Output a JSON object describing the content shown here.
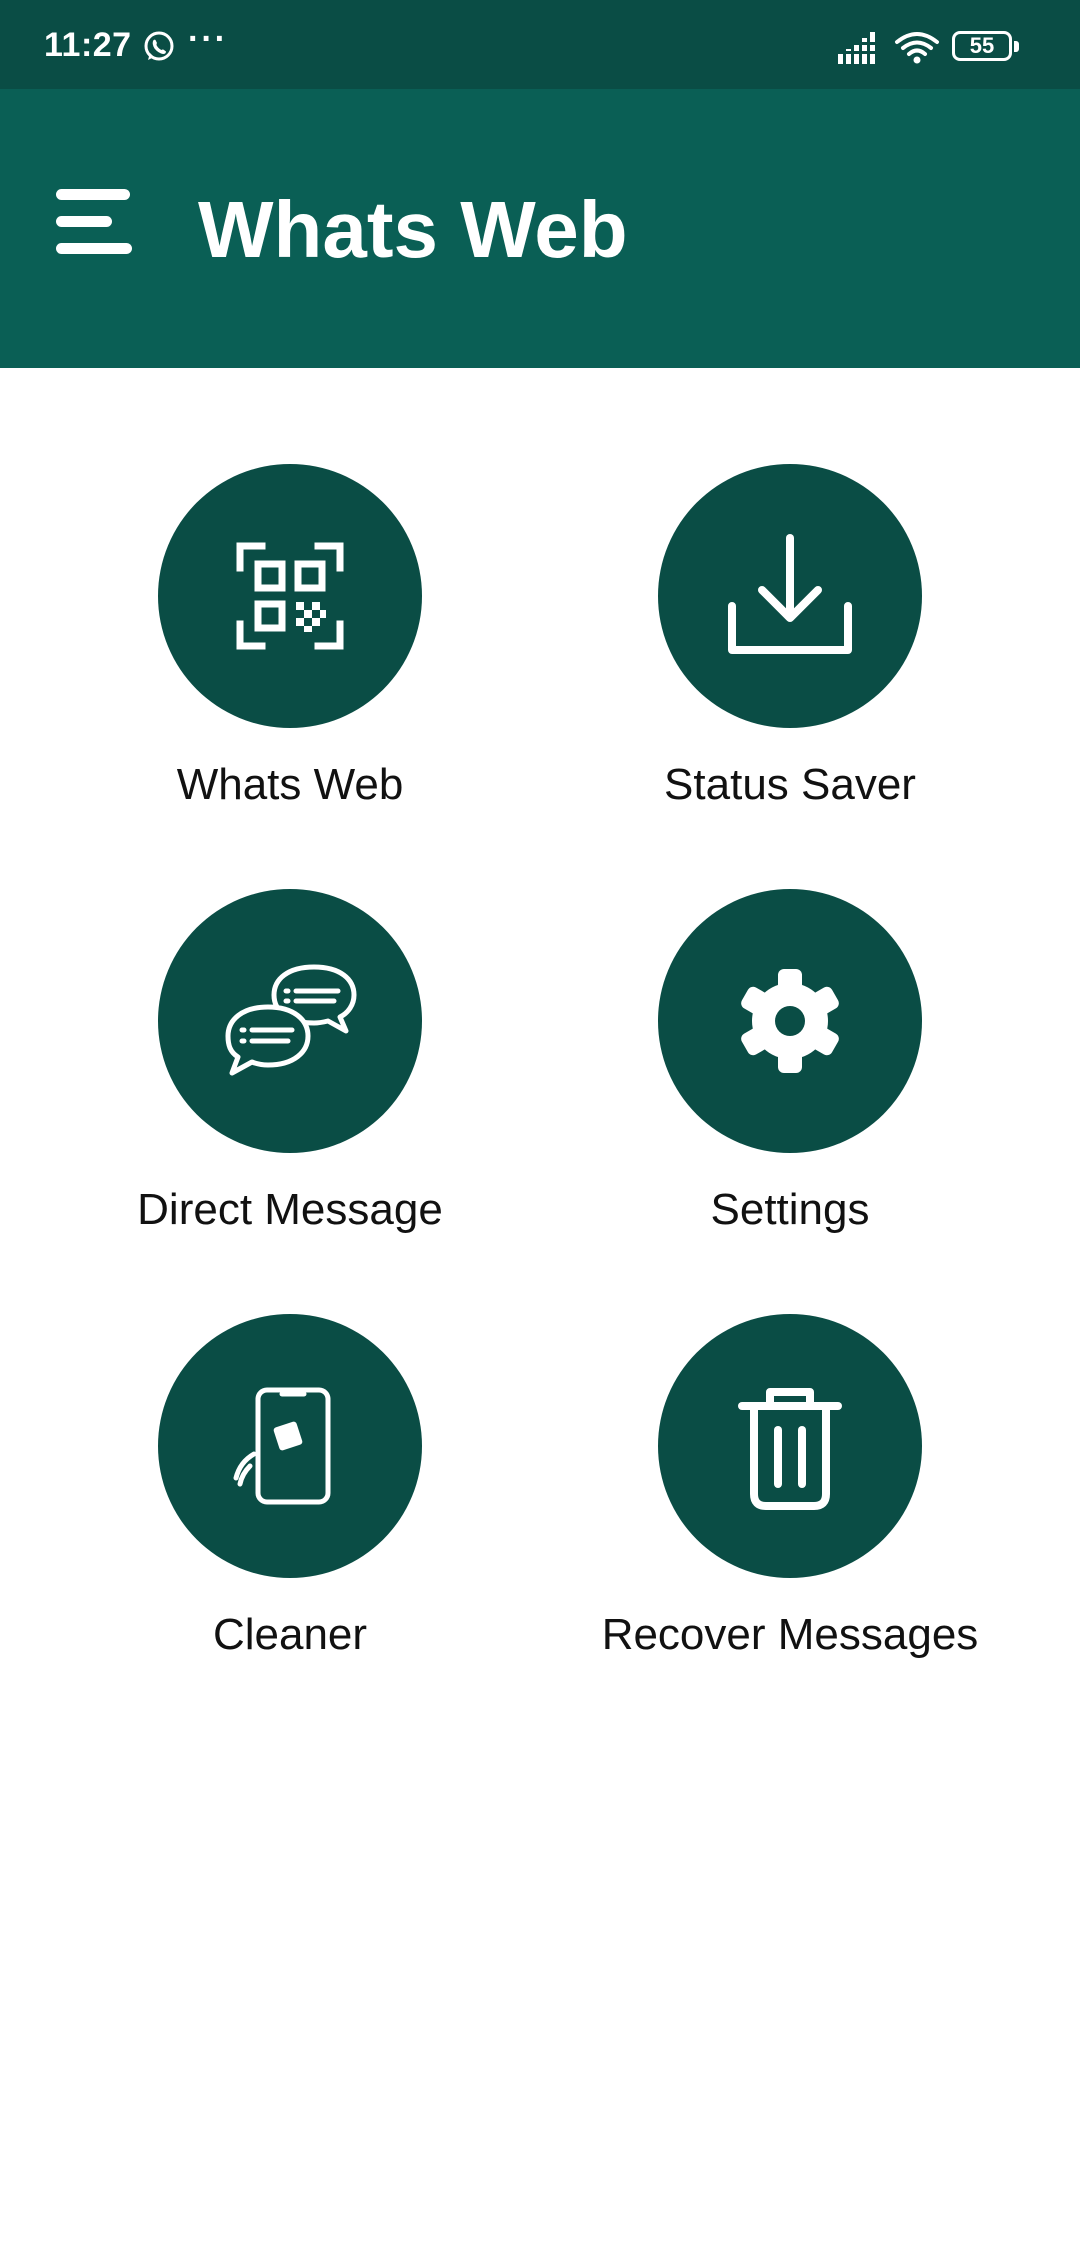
{
  "status_bar": {
    "time": "11:27",
    "more": "···",
    "battery_level": "55",
    "background_color": "#0a4d45",
    "icons": [
      "whatsapp-icon",
      "signal-icon",
      "wifi-icon",
      "battery-icon"
    ]
  },
  "app_bar": {
    "title": "Whats Web",
    "menu_icon": "hamburger-menu-icon",
    "background_color": "#0a5f55"
  },
  "tiles": [
    {
      "label": "Whats Web",
      "icon": "qr-code-scan-icon"
    },
    {
      "label": "Status Saver",
      "icon": "download-icon"
    },
    {
      "label": "Direct Message",
      "icon": "chat-bubbles-icon"
    },
    {
      "label": "Settings",
      "icon": "gear-icon"
    },
    {
      "label": "Cleaner",
      "icon": "phone-cleaner-icon"
    },
    {
      "label": "Recover Messages",
      "icon": "trash-icon"
    }
  ],
  "colors": {
    "tile_circle": "#0a4d45",
    "label_text": "#111111"
  }
}
